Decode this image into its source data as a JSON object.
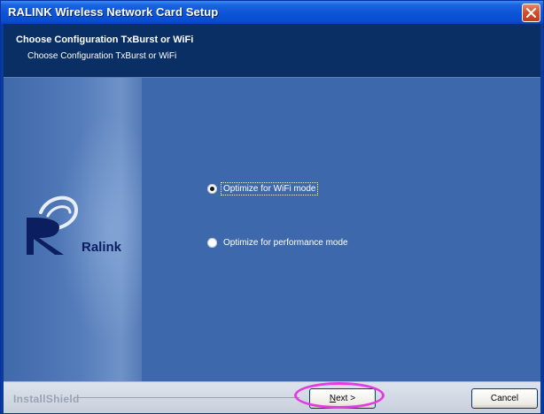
{
  "window": {
    "title": "RALINK Wireless Network Card Setup"
  },
  "header": {
    "title": "Choose Configuration TxBurst or WiFi",
    "subtitle": "Choose Configuration TxBurst or WiFi"
  },
  "logo": {
    "text": "Ralink"
  },
  "options": [
    {
      "label": "Optimize for WiFi mode",
      "selected": true
    },
    {
      "label": "Optimize for performance mode",
      "selected": false
    }
  ],
  "footer": {
    "brand": "InstallShield",
    "next_mnemonic": "N",
    "next_rest": "ext >",
    "cancel_label": "Cancel"
  },
  "colors": {
    "titlebar": "#0b54d6",
    "header_bg": "#0a2f64",
    "content_bg": "#3d68ab",
    "highlight": "#e53be0"
  },
  "icons": [
    "close-icon",
    "radio-icon",
    "ralink-logo-icon"
  ]
}
